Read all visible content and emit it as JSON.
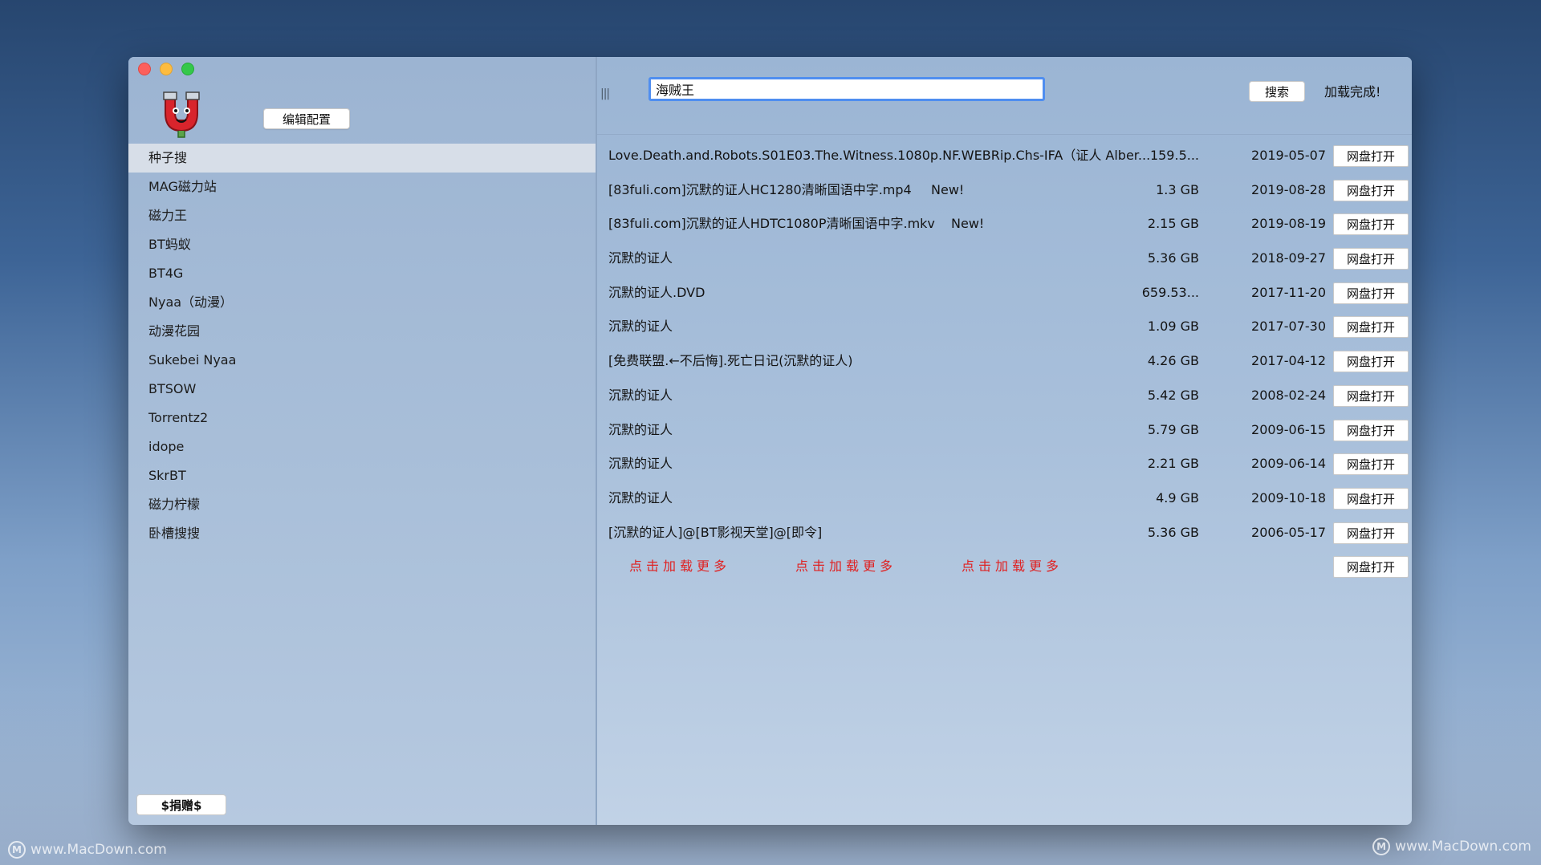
{
  "window": {
    "controls": [
      "close",
      "minimize",
      "zoom"
    ]
  },
  "sidebar": {
    "logo_icon": "magnet-mascot-icon",
    "edit_config_label": "编辑配置",
    "items": [
      {
        "label": "种子搜",
        "selected": true
      },
      {
        "label": "MAG磁力站"
      },
      {
        "label": "磁力王"
      },
      {
        "label": "BT蚂蚁"
      },
      {
        "label": "BT4G"
      },
      {
        "label": "Nyaa（动漫）"
      },
      {
        "label": "动漫花园"
      },
      {
        "label": "Sukebei Nyaa"
      },
      {
        "label": "BTSOW"
      },
      {
        "label": "Torrentz2"
      },
      {
        "label": "idope"
      },
      {
        "label": "SkrBT"
      },
      {
        "label": "磁力柠檬"
      },
      {
        "label": "卧槽搜搜"
      }
    ],
    "donate_label": "$捐赠$"
  },
  "toolbar": {
    "split_handle": "|||",
    "search_value": "海贼王",
    "search_button": "搜索",
    "status": "加载完成!"
  },
  "results": {
    "open_button_label": "网盘打开",
    "rows": [
      {
        "title": "Love.Death.and.Robots.S01E03.The.Witness.1080p.NF.WEBRip.Chs-IFA（证人 Alber...",
        "new": "",
        "size": "159.5...",
        "date": "2019-05-07"
      },
      {
        "title": "[83fuli.com]沉默的证人HC1280清晰国语中字.mp4",
        "new": "New!",
        "size": "1.3 GB",
        "date": "2019-08-28"
      },
      {
        "title": "[83fuli.com]沉默的证人HDTC1080P清晰国语中字.mkv",
        "new": "New!",
        "size": "2.15 GB",
        "date": "2019-08-19"
      },
      {
        "title": "沉默的证人",
        "new": "",
        "size": "5.36 GB",
        "date": "2018-09-27"
      },
      {
        "title": "沉默的证人.DVD",
        "new": "",
        "size": "659.53...",
        "date": "2017-11-20"
      },
      {
        "title": "沉默的证人",
        "new": "",
        "size": "1.09 GB",
        "date": "2017-07-30"
      },
      {
        "title": "[免费联盟.←不后悔].死亡日记(沉默的证人)",
        "new": "",
        "size": "4.26 GB",
        "date": "2017-04-12"
      },
      {
        "title": "沉默的证人",
        "new": "",
        "size": "5.42 GB",
        "date": "2008-02-24"
      },
      {
        "title": "沉默的证人",
        "new": "",
        "size": "5.79 GB",
        "date": "2009-06-15"
      },
      {
        "title": "沉默的证人",
        "new": "",
        "size": "2.21 GB",
        "date": "2009-06-14"
      },
      {
        "title": "沉默的证人",
        "new": "",
        "size": "4.9 GB",
        "date": "2009-10-18"
      },
      {
        "title": "[沉默的证人]@[BT影视天堂]@[即令]",
        "new": "",
        "size": "5.36 GB",
        "date": "2006-05-17"
      }
    ],
    "load_more": [
      "点击加载更多",
      "点击加载更多",
      "点击加载更多"
    ]
  },
  "watermarks": {
    "left": "www.MacDown.com",
    "right": "www.MacDown.com"
  },
  "colors": {
    "accent": "#4f8ef0",
    "load_more": "#e02020",
    "selection": "#d7dee8"
  }
}
